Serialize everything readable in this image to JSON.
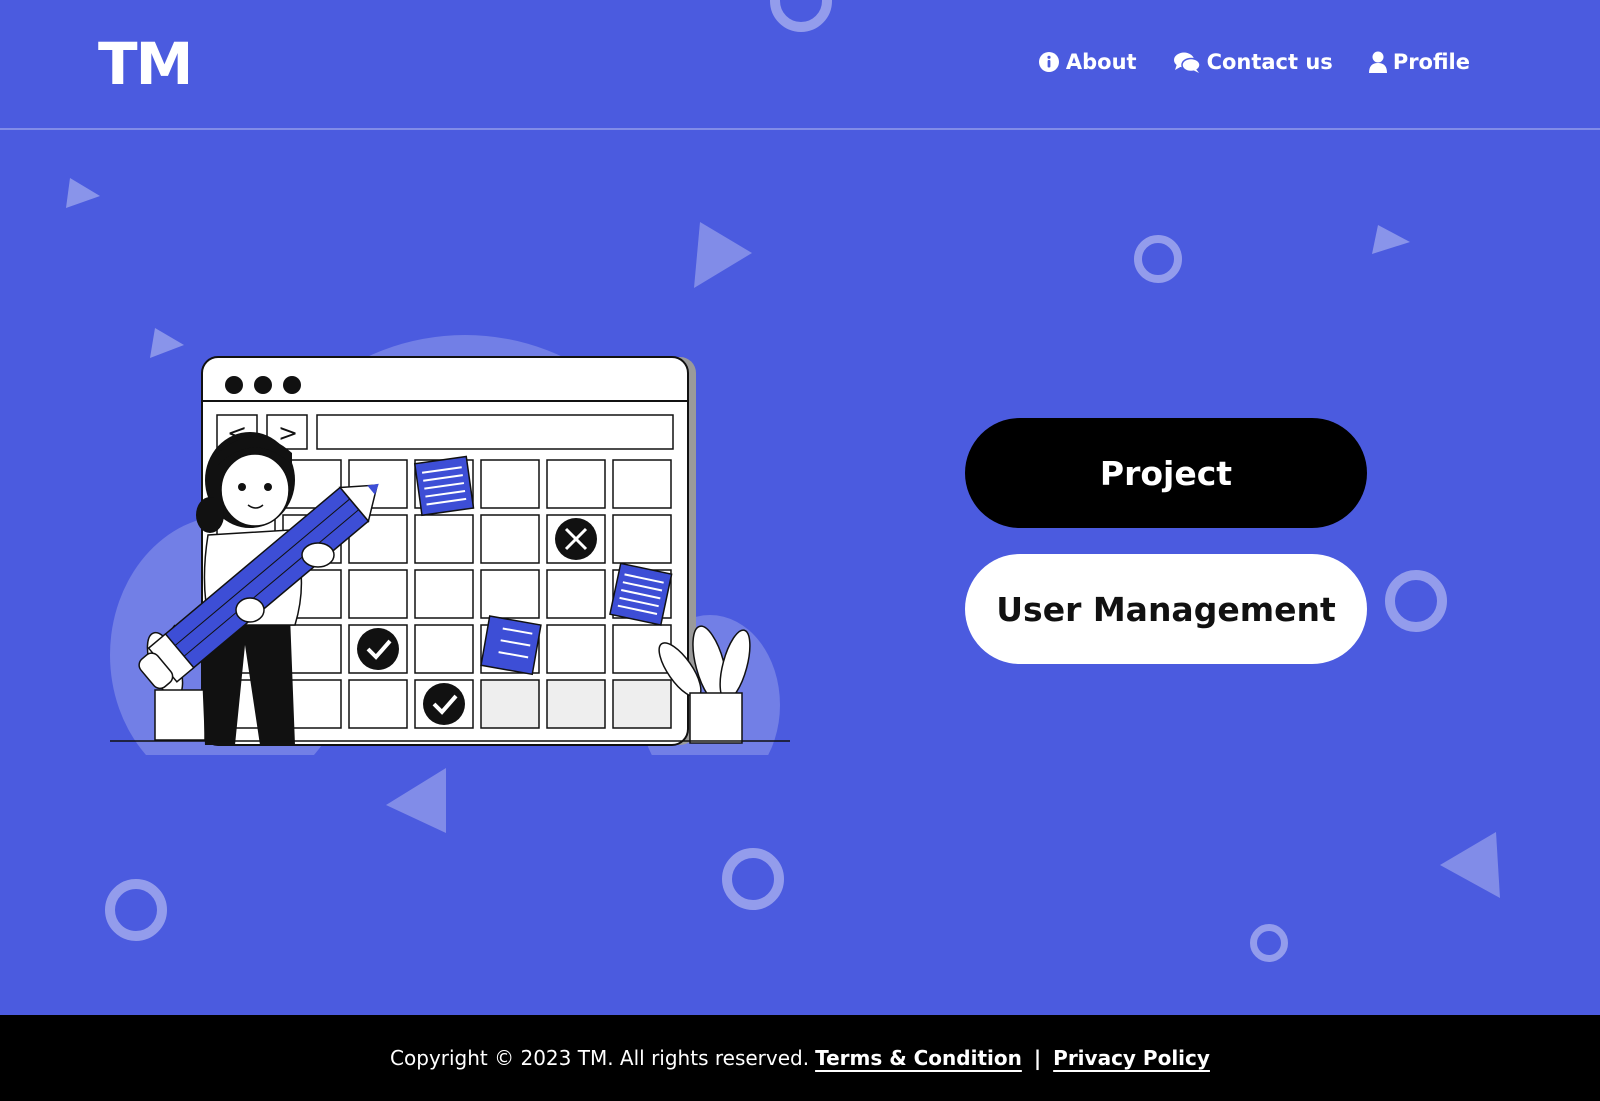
{
  "brand": {
    "logo": "TM"
  },
  "nav": {
    "about": {
      "label": "About",
      "icon": "info-icon"
    },
    "contact": {
      "label": "Contact us",
      "icon": "chat-icon"
    },
    "profile": {
      "label": "Profile",
      "icon": "user-icon"
    }
  },
  "actions": {
    "project_label": "Project",
    "user_management_label": "User Management"
  },
  "footer": {
    "copyright": "Copyright ©  2023 TM. All rights reserved.",
    "terms_label": "Terms & Condition",
    "separator": "|",
    "privacy_label": "Privacy Policy"
  },
  "colors": {
    "background": "#4b5bdf",
    "accent": "#3d4ed6",
    "footer": "#000000",
    "primary_button": "#000000",
    "secondary_button": "#ffffff"
  },
  "illustration": {
    "description_icon": "calendar-planner-illustration"
  }
}
